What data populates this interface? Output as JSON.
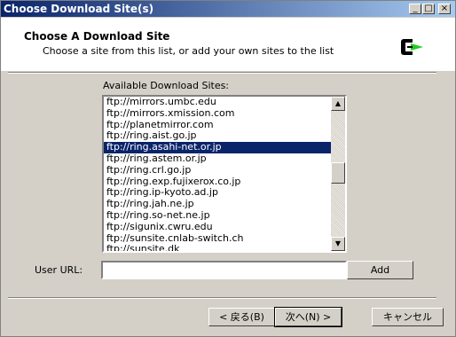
{
  "window": {
    "title": "Choose Download Site(s)"
  },
  "header": {
    "title": "Choose A Download Site",
    "subtitle": "Choose a site from this list, or add your own sites to the list",
    "logo": "cygwin-setup-logo"
  },
  "sites_label": "Available Download Sites:",
  "sites": [
    "ftp://mirrors.umbc.edu",
    "ftp://mirrors.xmission.com",
    "ftp://planetmirror.com",
    "ftp://ring.aist.go.jp",
    "ftp://ring.asahi-net.or.jp",
    "ftp://ring.astem.or.jp",
    "ftp://ring.crl.go.jp",
    "ftp://ring.exp.fujixerox.co.jp",
    "ftp://ring.ip-kyoto.ad.jp",
    "ftp://ring.jah.ne.jp",
    "ftp://ring.so-net.ne.jp",
    "ftp://sigunix.cwru.edu",
    "ftp://sunsite.cnlab-switch.ch",
    "ftp://sunsite.dk"
  ],
  "selected_index": 4,
  "user_url": {
    "label": "User URL:",
    "value": ""
  },
  "buttons": {
    "add": "Add",
    "back": "< 戻る(B)",
    "next": "次へ(N) >",
    "cancel": "キャンセル"
  },
  "colors": {
    "titlebar_start": "#0a246a",
    "titlebar_end": "#a6caf0",
    "selection": "#0a246a",
    "logo_green": "#22cc22"
  }
}
